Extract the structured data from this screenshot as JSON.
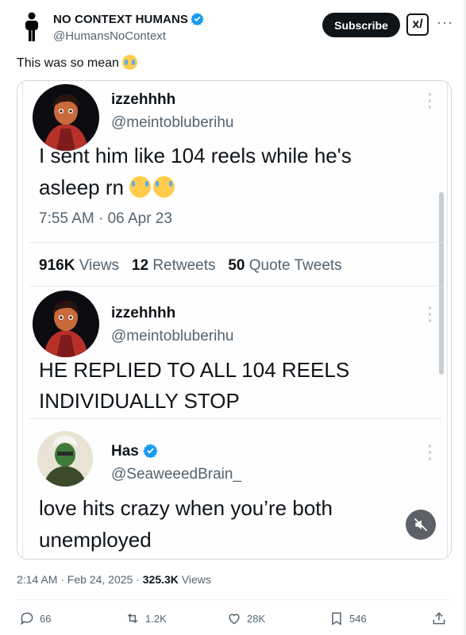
{
  "post": {
    "author_name": "NO CONTEXT HUMANS",
    "author_handle": "@HumansNoContext",
    "subscribe_label": "Subscribe",
    "grok_label": "x/",
    "more_label": "···",
    "text": "This was so mean",
    "text_emoji": "loudly-crying-face-emoji"
  },
  "embedded": {
    "tweet1": {
      "name": "izzehhhh",
      "handle": "@meintobluberihu",
      "line1": "I sent him like 104 reels while he's",
      "line2": "asleep rn",
      "time": "7:55 AM · 06 Apr 23",
      "views_count": "916K",
      "views_label": "Views",
      "retweets_count": "12",
      "retweets_label": "Retweets",
      "quotes_count": "50",
      "quotes_label": "Quote Tweets"
    },
    "tweet2": {
      "name": "izzehhhh",
      "handle": "@meintobluberihu",
      "line1": "HE REPLIED TO ALL 104 REELS",
      "line2": "INDIVIDUALLY STOP"
    },
    "tweet3": {
      "name": "Has",
      "handle": "@SeaweeedBrain_",
      "line1": "love hits crazy when you’re both",
      "line2": "unemployed"
    }
  },
  "footer": {
    "time": "2:14 AM · Feb 24, 2025 · ",
    "views_count": "325.3K",
    "views_label": " Views",
    "replies": "66",
    "reposts": "1.2K",
    "likes": "28K",
    "bookmarks": "546"
  },
  "colors": {
    "text": "#0f1419",
    "secondary": "#536471",
    "verified": "#1d9bf0",
    "border": "#cfd9de"
  },
  "icons": [
    "person-icon",
    "verified-badge-icon",
    "grok-icon",
    "more-icon",
    "mute-icon",
    "reply-icon",
    "repost-icon",
    "like-icon",
    "bookmark-icon",
    "share-icon"
  ]
}
